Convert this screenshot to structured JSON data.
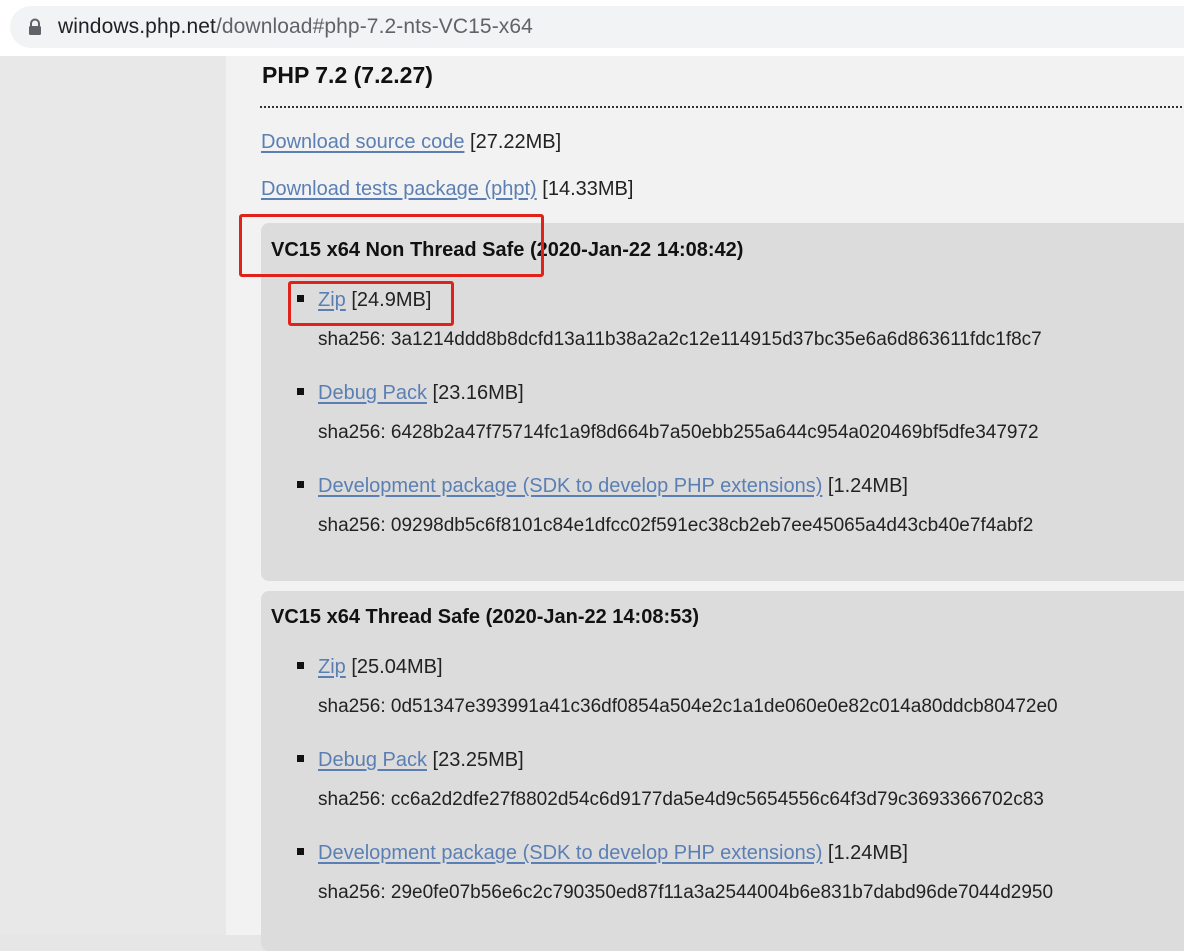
{
  "browser": {
    "url_host": "windows.php.net",
    "url_path": "/download#php-7.2-nts-VC15-x64"
  },
  "release": {
    "title": "PHP 7.2 (7.2.27)",
    "downloads": [
      {
        "link": "Download source code",
        "size": "[27.22MB]"
      },
      {
        "link": "Download tests package (phpt)",
        "size": "[14.33MB]"
      }
    ]
  },
  "builds": [
    {
      "title": "VC15 x64 Non Thread Safe",
      "date": "(2020-Jan-22 14:08:42)",
      "packages": [
        {
          "link": "Zip",
          "size": "[24.9MB]",
          "sha": "sha256: 3a1214ddd8b8dcfd13a11b38a2a2c12e114915d37bc35e6a6d863611fdc1f8c7"
        },
        {
          "link": "Debug Pack",
          "size": "[23.16MB]",
          "sha": "sha256: 6428b2a47f75714fc1a9f8d664b7a50ebb255a644c954a020469bf5dfe347972"
        },
        {
          "link": "Development package (SDK to develop PHP extensions)",
          "size": "[1.24MB]",
          "sha": "sha256: 09298db5c6f8101c84e1dfcc02f591ec38cb2eb7ee45065a4d43cb40e7f4abf2"
        }
      ]
    },
    {
      "title": "VC15 x64 Thread Safe",
      "date": "(2020-Jan-22 14:08:53)",
      "packages": [
        {
          "link": "Zip",
          "size": "[25.04MB]",
          "sha": "sha256: 0d51347e393991a41c36df0854a504e2c1a1de060e0e82c014a80ddcb80472e0"
        },
        {
          "link": "Debug Pack",
          "size": "[23.25MB]",
          "sha": "sha256: cc6a2d2dfe27f8802d54c6d9177da5e4d9c5654556c64f3d79c3693366702c83"
        },
        {
          "link": "Development package (SDK to develop PHP extensions)",
          "size": "[1.24MB]",
          "sha": "sha256: 29e0fe07b56e6c2c790350ed87f11a3a2544004b6e831b7dabd96de7044d2950"
        }
      ]
    }
  ],
  "colors": {
    "link": "#5b7fb3",
    "highlight": "#e0221a"
  }
}
